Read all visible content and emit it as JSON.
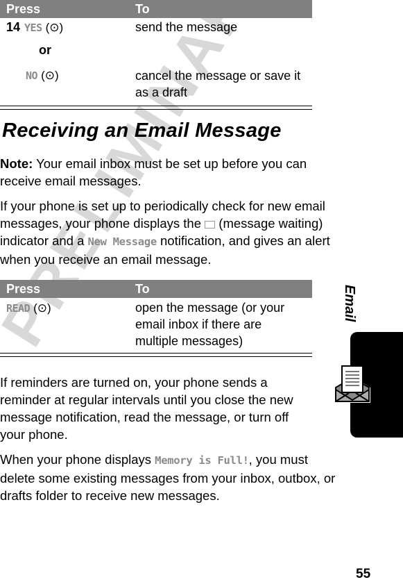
{
  "watermark": "PRELIMINARY",
  "table1": {
    "headers": [
      "Press",
      "To"
    ],
    "step": "14",
    "rows": [
      {
        "key": "YES",
        "key_symbol": "(⊙)",
        "action": "send the message"
      },
      {
        "connector": "or"
      },
      {
        "key": "NO",
        "key_symbol": "(⊙)",
        "action": "cancel the message or save it as a draft"
      }
    ]
  },
  "section": {
    "title": "Receiving an Email Message",
    "note_label": "Note:",
    "note_text": " Your email inbox must be set up before you can receive email messages.",
    "para1": {
      "part1": "If your phone is set up to periodically check for new email messages, your phone displays the ",
      "indicator_icon": "message-waiting-envelope",
      "part2": " (message waiting) indicator and a ",
      "display_text": "New Message",
      "part3": " notification, and gives an alert when you receive an email message."
    }
  },
  "table2": {
    "headers": [
      "Press",
      "To"
    ],
    "rows": [
      {
        "key": "READ",
        "key_symbol": "(⊙)",
        "action": "open the message (or your email inbox if there are multiple messages)"
      }
    ]
  },
  "para2": "If reminders are turned on, your phone sends a reminder at regular intervals until you close the new message notification, read the message, or turn off your phone.",
  "para3": {
    "part1": "When your phone displays ",
    "display_text": "Memory is Full!",
    "part2": ", you must delete some existing messages from your inbox, outbox, or drafts folder to receive new messages."
  },
  "side_tab": {
    "title": "Email",
    "icon": "email-envelope-icon"
  },
  "page_number": "55"
}
